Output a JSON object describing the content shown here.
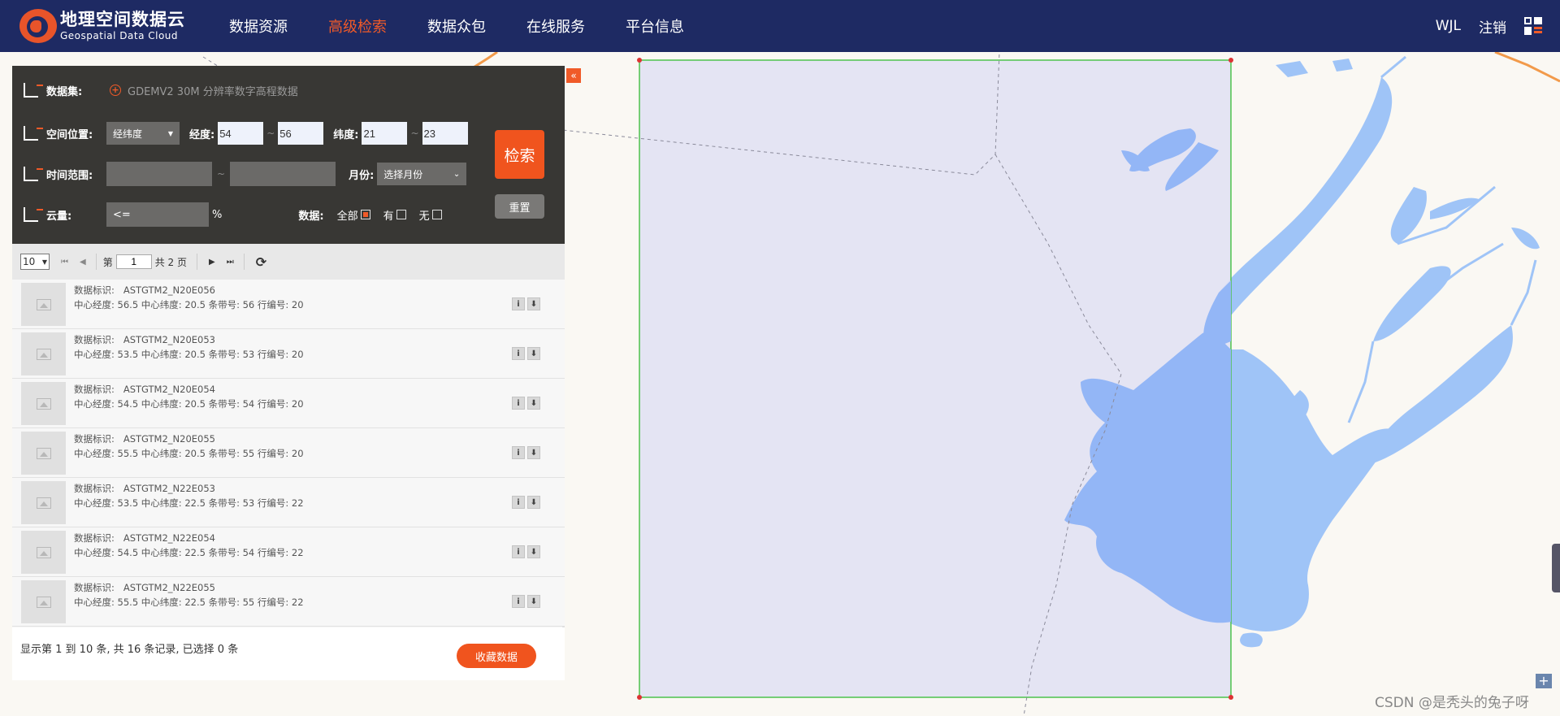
{
  "app": {
    "logo_cn": "地理空间数据云",
    "logo_en": "Geospatial Data Cloud"
  },
  "nav": {
    "items": [
      {
        "label": "数据资源",
        "active": false
      },
      {
        "label": "高级检索",
        "active": true
      },
      {
        "label": "数据众包",
        "active": false
      },
      {
        "label": "在线服务",
        "active": false
      },
      {
        "label": "平台信息",
        "active": false
      }
    ],
    "user": "WJL",
    "logout": "注销"
  },
  "search": {
    "collapse_symbol": "«",
    "dataset_label": "数据集:",
    "dataset_value": "GDEMV2 30M 分辨率数字高程数据",
    "location_label": "空间位置:",
    "location_mode": "经纬度",
    "lon_label": "经度:",
    "lon_min": "54",
    "lon_max": "56",
    "lat_label": "纬度:",
    "lat_min": "21",
    "lat_max": "23",
    "time_label": "时间范围:",
    "month_label": "月份:",
    "month_placeholder": "选择月份",
    "cloud_label": "云量:",
    "cloud_value": "<=",
    "cloud_unit": "%",
    "data_label": "数据:",
    "data_options": [
      {
        "label": "全部",
        "checked": true
      },
      {
        "label": "有",
        "checked": false
      },
      {
        "label": "无",
        "checked": false
      }
    ],
    "search_button": "检索",
    "reset_button": "重置",
    "range_sep": "~"
  },
  "pager": {
    "page_size": "10",
    "page_prefix": "第",
    "current_page": "1",
    "total_pages_text": "共 2 页"
  },
  "results": [
    {
      "id_label": "数据标识:",
      "id": "ASTGTM2_N20E056",
      "info": "中心经度: 56.5 中心纬度: 20.5 条带号: 56 行编号: 20"
    },
    {
      "id_label": "数据标识:",
      "id": "ASTGTM2_N20E053",
      "info": "中心经度: 53.5 中心纬度: 20.5 条带号: 53 行编号: 20"
    },
    {
      "id_label": "数据标识:",
      "id": "ASTGTM2_N20E054",
      "info": "中心经度: 54.5 中心纬度: 20.5 条带号: 54 行编号: 20"
    },
    {
      "id_label": "数据标识:",
      "id": "ASTGTM2_N20E055",
      "info": "中心经度: 55.5 中心纬度: 20.5 条带号: 55 行编号: 20"
    },
    {
      "id_label": "数据标识:",
      "id": "ASTGTM2_N22E053",
      "info": "中心经度: 53.5 中心纬度: 22.5 条带号: 53 行编号: 22"
    },
    {
      "id_label": "数据标识:",
      "id": "ASTGTM2_N22E054",
      "info": "中心经度: 54.5 中心纬度: 22.5 条带号: 54 行编号: 22"
    },
    {
      "id_label": "数据标识:",
      "id": "ASTGTM2_N22E055",
      "info": "中心经度: 55.5 中心纬度: 22.5 条带号: 55 行编号: 22"
    }
  ],
  "footer": {
    "summary": "显示第 1 到 10 条, 共 16 条记录, 已选择 0 条",
    "favorite_button": "收藏数据"
  },
  "map": {
    "zoom_in": "+",
    "water_color": "#9fc4f7",
    "selection_fill": "#e2e2f3",
    "selection_stroke": "#4cc24c",
    "accent_color": "#f05a28",
    "nav_color": "#1e2a63"
  },
  "watermark": "CSDN @是秃头的兔子呀"
}
